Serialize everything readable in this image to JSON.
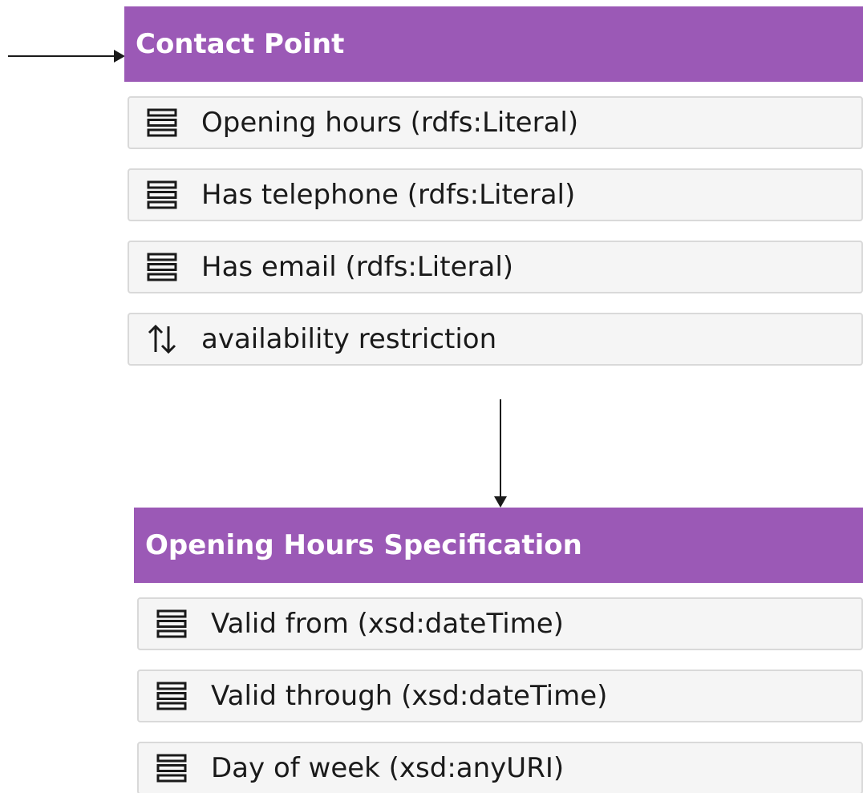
{
  "entities": [
    {
      "title": "Contact Point",
      "properties": [
        {
          "icon": "list-lines-icon",
          "label": "Opening hours (rdfs:Literal)"
        },
        {
          "icon": "list-lines-icon",
          "label": "Has telephone (rdfs:Literal)"
        },
        {
          "icon": "list-lines-icon",
          "label": "Has email (rdfs:Literal)"
        },
        {
          "icon": "up-down-arrows-icon",
          "label": "availability restriction"
        }
      ]
    },
    {
      "title": "Opening Hours Specification",
      "properties": [
        {
          "icon": "list-lines-icon",
          "label": "Valid from (xsd:dateTime)"
        },
        {
          "icon": "list-lines-icon",
          "label": "Valid through (xsd:dateTime)"
        },
        {
          "icon": "list-lines-icon",
          "label": "Day of week (xsd:anyURI)"
        }
      ]
    }
  ],
  "colors": {
    "header": "#9b59b6",
    "header_text": "#ffffff",
    "property_bg": "#f5f5f5",
    "property_border": "#d9d9d9",
    "connector": "#1a1a1a"
  }
}
